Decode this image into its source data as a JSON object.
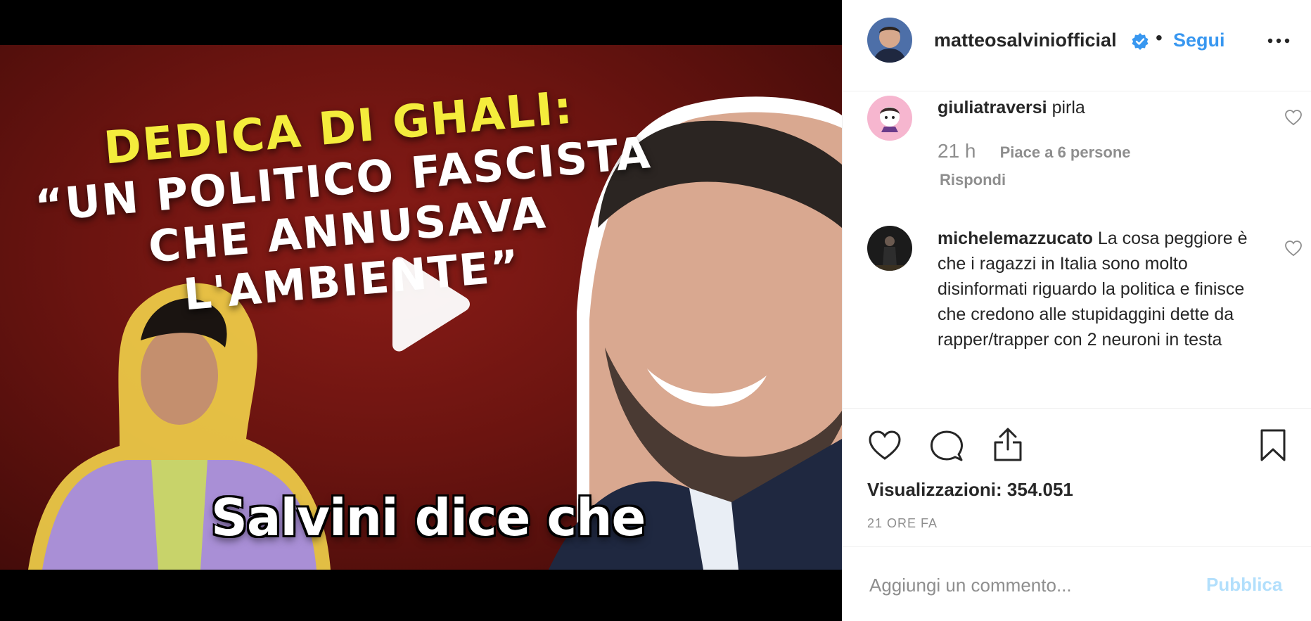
{
  "video": {
    "headline_line1": "DEDICA DI GHALI:",
    "headline_line2": "“UN POLITICO FASCISTA",
    "headline_line3": "CHE ANNUSAVA L'AMBIENTE”",
    "caption": "Salvini dice che",
    "play_icon": "play-icon"
  },
  "header": {
    "username": "matteosalviniofficial",
    "verified_icon": "verified-badge-icon",
    "separator": "•",
    "follow_label": "Segui",
    "more_icon": "more-options-icon"
  },
  "comments": [
    {
      "user": "giuliatraversi",
      "text": "pirla",
      "time": "21 h",
      "likes": "Piace a 6 persone",
      "reply": "Rispondi"
    },
    {
      "user": "michelemazzucato",
      "text": "La cosa peggiore è che i ragazzi in Italia sono molto disinformati riguardo la politica e finisce che credono alle stupidaggini dette da rapper/trapper con 2 neuroni in testa"
    }
  ],
  "actions": {
    "icons": [
      "heart-icon",
      "comment-icon",
      "share-icon",
      "bookmark-icon"
    ],
    "views_label": "Visualizzazioni: 354.051",
    "posted": "21 ORE FA"
  },
  "add_comment": {
    "placeholder": "Aggiungi un commento...",
    "publish_label": "Pubblica"
  },
  "colors": {
    "link_blue": "#3897f0",
    "publish_disabled": "#b2dffc",
    "headline_yellow": "#f4ec3c",
    "video_bg": "#6b1410"
  }
}
